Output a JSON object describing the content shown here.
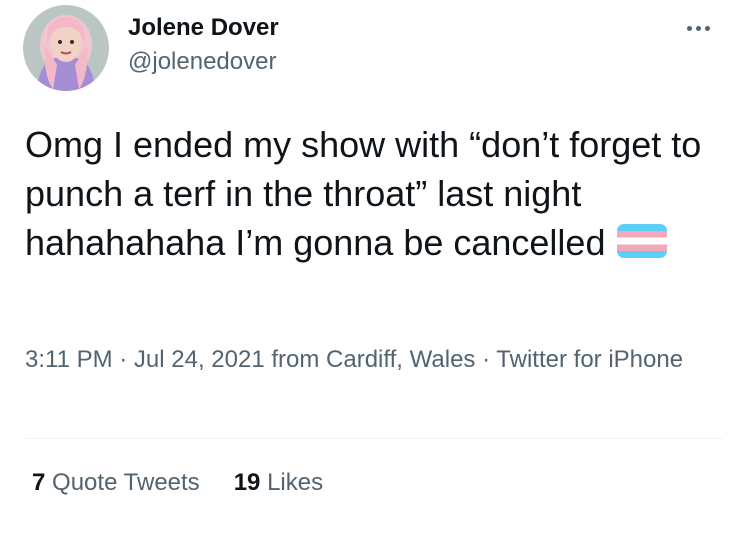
{
  "user": {
    "display_name": "Jolene Dover",
    "handle": "@jolenedover",
    "avatar_icon": "user-avatar"
  },
  "tweet": {
    "text": "Omg I ended my show with “don’t forget to punch a terf in the throat” last night hahahahaha I’m gonna be cancelled",
    "emoji": "transgender-flag",
    "timestamp": "3:11 PM · Jul 24, 2021 from Cardiff, Wales · Twitter for iPhone"
  },
  "stats": {
    "quote_tweets_count": "7",
    "quote_tweets_label": "Quote Tweets",
    "likes_count": "19",
    "likes_label": "Likes"
  },
  "colors": {
    "text_primary": "#0f1419",
    "text_secondary": "#536471",
    "divider": "#eff3f4",
    "flag_blue": "#5bcefa",
    "flag_pink": "#f5a9b8",
    "flag_white": "#ffffff"
  },
  "icons": {
    "more": "more-options-icon"
  }
}
